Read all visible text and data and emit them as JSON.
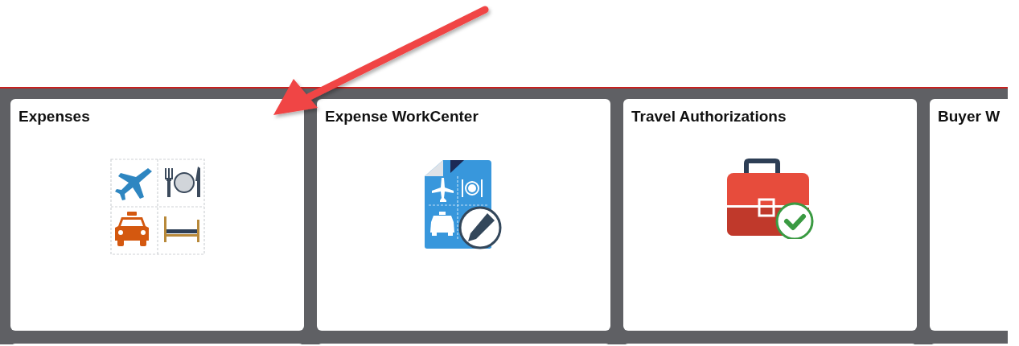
{
  "tiles": [
    {
      "title": "Expenses",
      "kind": "expenses"
    },
    {
      "title": "Expense WorkCenter",
      "kind": "workcenter"
    },
    {
      "title": "Travel Authorizations",
      "kind": "authorizations"
    },
    {
      "title": "Buyer W",
      "kind": "blank"
    }
  ]
}
